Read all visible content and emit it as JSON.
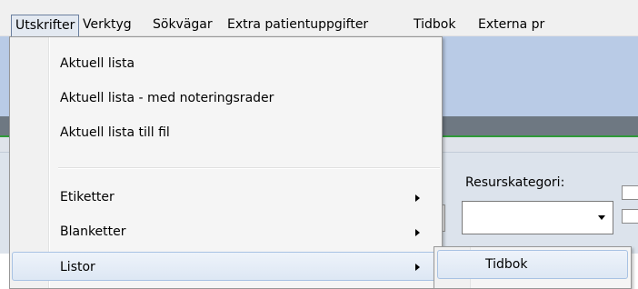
{
  "menubar": {
    "items": [
      "Utskrifter",
      "Verktyg",
      "Sökvägar",
      "Extra patientuppgifter",
      "Tidbok",
      "Externa pr"
    ],
    "active_index": 0
  },
  "dropdown": {
    "items": [
      {
        "label": "Aktuell lista",
        "has_submenu": false
      },
      {
        "label": "Aktuell lista - med noteringsrader",
        "has_submenu": false
      },
      {
        "label": "Aktuell lista till fil",
        "has_submenu": false
      },
      {
        "label": "Etiketter",
        "has_submenu": true
      },
      {
        "label": "Blanketter",
        "has_submenu": true
      },
      {
        "label": "Listor",
        "has_submenu": true,
        "highlighted": true
      }
    ]
  },
  "submenu": {
    "items": [
      {
        "label": "Tidbok",
        "highlighted": true
      }
    ]
  },
  "filters": {
    "resurskategori_label": "Resurskategori:",
    "resurskategori_value": ""
  },
  "colors": {
    "menu_bg": "#f5f5f5",
    "highlight_border": "#a8c2e3",
    "header_blue": "#b9cbe6",
    "green_line": "#2f9a39"
  }
}
